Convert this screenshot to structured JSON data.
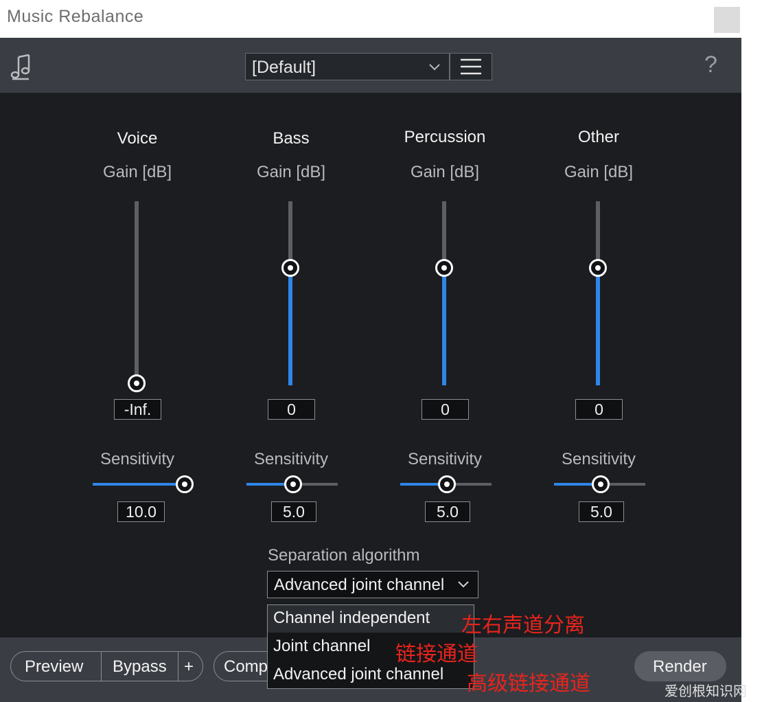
{
  "window": {
    "title": "Music Rebalance"
  },
  "toolbar": {
    "preset_value": "[Default]",
    "help_label": "?"
  },
  "columns": [
    {
      "name": "Voice",
      "gain_label": "Gain [dB]",
      "gain_value": "-Inf.",
      "sensitivity_label": "Sensitivity",
      "sensitivity_value": "10.0"
    },
    {
      "name": "Bass",
      "gain_label": "Gain [dB]",
      "gain_value": "0",
      "sensitivity_label": "Sensitivity",
      "sensitivity_value": "5.0"
    },
    {
      "name": "Percussion",
      "gain_label": "Gain [dB]",
      "gain_value": "0",
      "sensitivity_label": "Sensitivity",
      "sensitivity_value": "5.0"
    },
    {
      "name": "Other",
      "gain_label": "Gain [dB]",
      "gain_value": "0",
      "sensitivity_label": "Sensitivity",
      "sensitivity_value": "5.0"
    }
  ],
  "separation": {
    "label": "Separation algorithm",
    "selected": "Advanced joint channel",
    "options": [
      "Channel independent",
      "Joint channel",
      "Advanced joint channel"
    ]
  },
  "annotations": [
    "左右声道分离",
    "链接通道",
    "高级链接通道"
  ],
  "bottom": {
    "preview": "Preview",
    "bypass": "Bypass",
    "plus": "+",
    "comp": "Comp",
    "render": "Render"
  },
  "watermark": "爱创根知识网",
  "colors": {
    "accent": "#2f86e8",
    "panel": "#1b1d20",
    "bar": "#3a3e44",
    "annotation": "#e8241d"
  }
}
